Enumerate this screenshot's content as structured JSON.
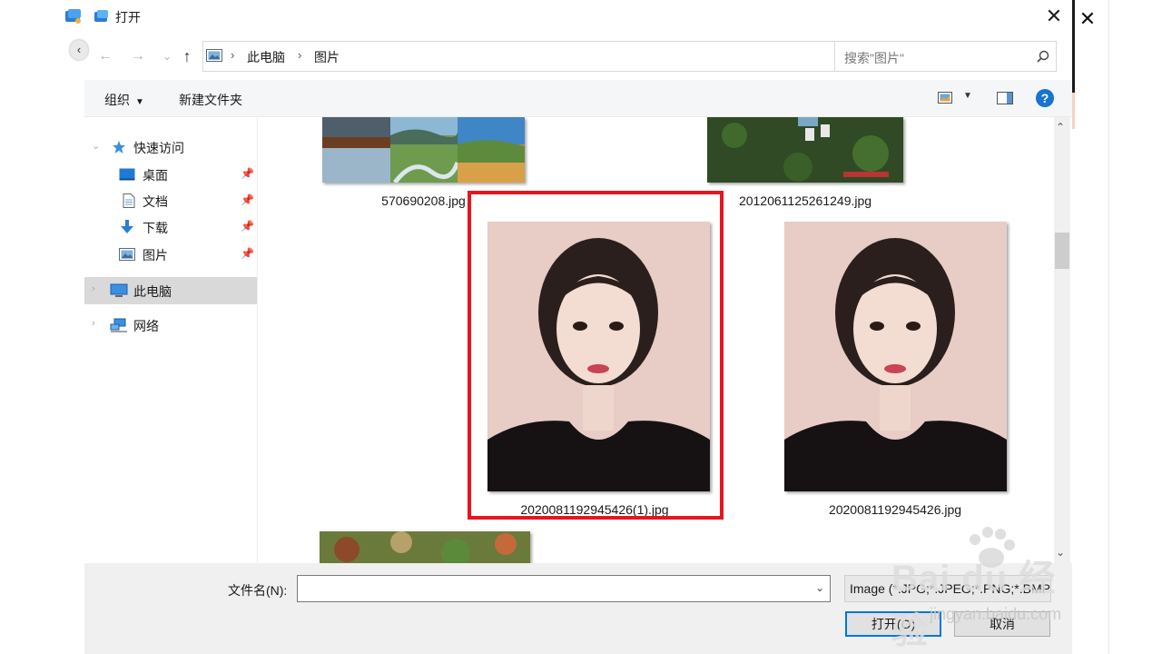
{
  "dialog": {
    "title": "打开",
    "close_glyph": "✕"
  },
  "navigation": {
    "back_glyph": "←",
    "forward_glyph": "→",
    "recent_glyph": "⌄",
    "up_glyph": "↑",
    "address": {
      "segments": [
        "此电脑",
        "图片"
      ]
    },
    "search_placeholder": "搜索\"图片\""
  },
  "toolbar": {
    "organize_label": "组织",
    "new_folder_label": "新建文件夹",
    "help_glyph": "?"
  },
  "sidebar": {
    "quick_access": {
      "label": "快速访问"
    },
    "items": [
      {
        "label": "桌面",
        "icon": "desktop-icon",
        "pinned": true
      },
      {
        "label": "文档",
        "icon": "document-icon",
        "pinned": true
      },
      {
        "label": "下载",
        "icon": "download-icon",
        "pinned": true
      },
      {
        "label": "图片",
        "icon": "pictures-icon",
        "pinned": true
      }
    ],
    "this_pc": {
      "label": "此电脑",
      "selected": true
    },
    "network": {
      "label": "网络"
    }
  },
  "files": [
    {
      "name": "570690208.jpg",
      "kind": "landscape"
    },
    {
      "name": "2012061125261249.jpg",
      "kind": "grass"
    },
    {
      "name": "2020081192945426(1).jpg",
      "kind": "portrait",
      "highlighted": true
    },
    {
      "name": "2020081192945426.jpg",
      "kind": "portrait"
    },
    {
      "name": "",
      "kind": "foliage"
    }
  ],
  "bottom": {
    "filename_label": "文件名(N):",
    "filename_value": "",
    "filetype_text": "Image (*.JPG;*.JPEG;*.PNG;*.BMP)",
    "open_label": "打开(O)",
    "cancel_label": "取消"
  },
  "watermark": {
    "main": "Bai du 经验",
    "sub": "jingyan.baidu.com"
  },
  "colors": {
    "highlight_border": "#e5161f",
    "accent": "#0078d7",
    "help": "#1874d0"
  }
}
